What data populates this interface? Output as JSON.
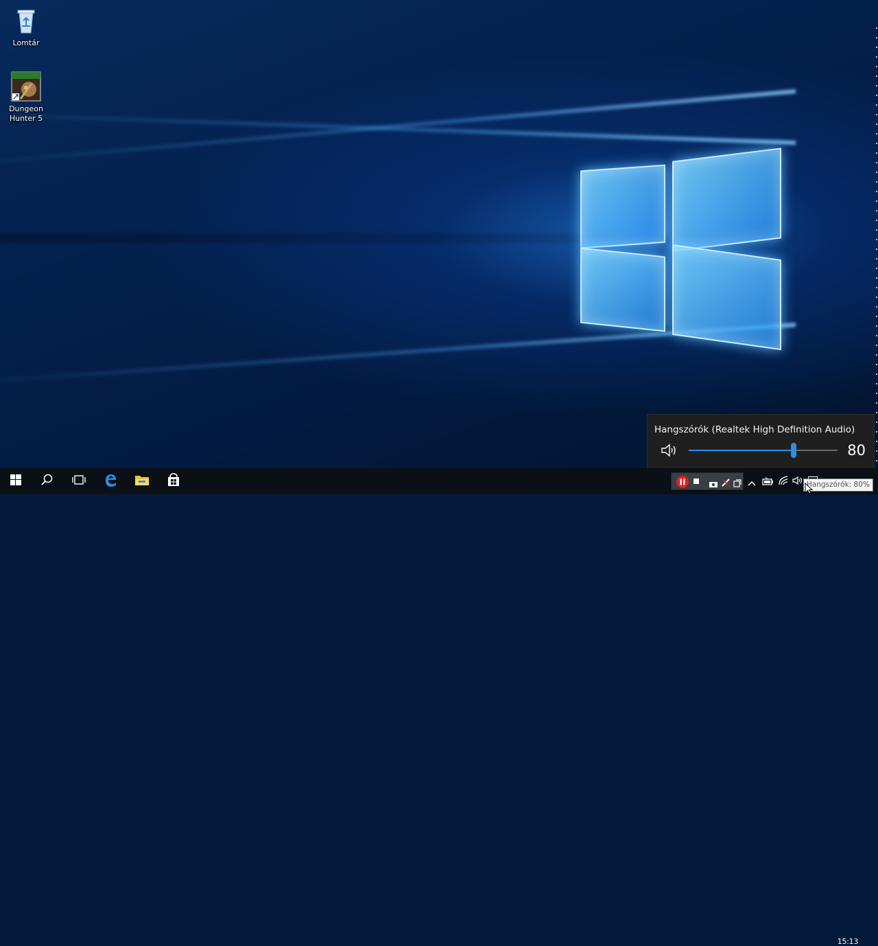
{
  "desktop": {
    "icons": [
      {
        "label": "Lomtár",
        "icon": "recycle-bin-icon"
      },
      {
        "label": "Dungeon\nHunter 5",
        "icon": "game-shortcut-icon"
      }
    ]
  },
  "volume_flyout": {
    "device_title": "Hangszórók (Realtek High Definition Audio)",
    "volume": 80,
    "volume_text": "80",
    "accent_color": "#2b8fe6"
  },
  "taskbar": {
    "buttons": [
      "start-icon",
      "search-icon",
      "task-view-icon",
      "edge-icon",
      "file-explorer-icon",
      "store-icon"
    ],
    "clock_time": "15:13",
    "tooltip": "Hangszórók: 80%"
  }
}
